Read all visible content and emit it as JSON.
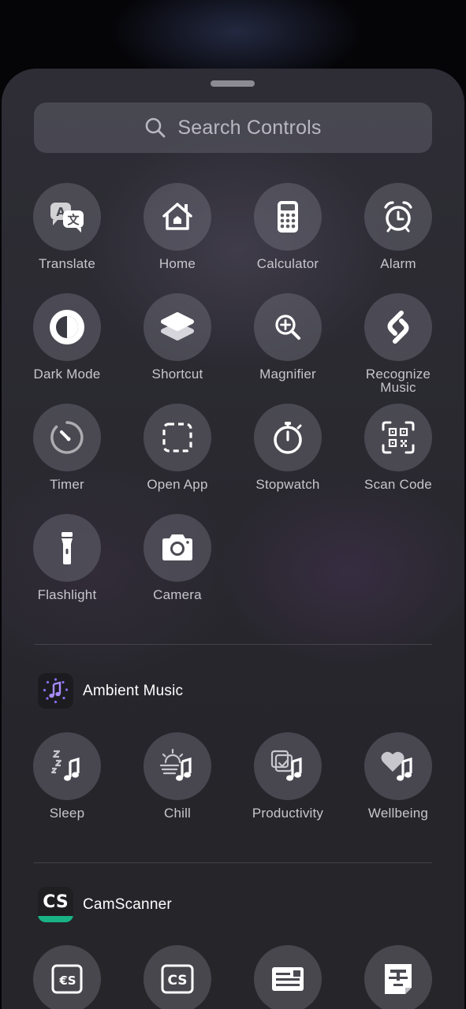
{
  "search": {
    "placeholder": "Search Controls"
  },
  "controls": [
    {
      "label": "Translate",
      "icon": "translate-icon"
    },
    {
      "label": "Home",
      "icon": "home-icon"
    },
    {
      "label": "Calculator",
      "icon": "calculator-icon"
    },
    {
      "label": "Alarm",
      "icon": "alarm-icon"
    },
    {
      "label": "Dark Mode",
      "icon": "dark-mode-icon"
    },
    {
      "label": "Shortcut",
      "icon": "shortcuts-icon"
    },
    {
      "label": "Magnifier",
      "icon": "magnifier-icon"
    },
    {
      "label": "Recognize Music",
      "icon": "shazam-icon"
    },
    {
      "label": "Timer",
      "icon": "timer-icon"
    },
    {
      "label": "Open App",
      "icon": "open-app-icon"
    },
    {
      "label": "Stopwatch",
      "icon": "stopwatch-icon"
    },
    {
      "label": "Scan Code",
      "icon": "qr-code-icon"
    },
    {
      "label": "Flashlight",
      "icon": "flashlight-icon"
    },
    {
      "label": "Camera",
      "icon": "camera-icon"
    }
  ],
  "ambient": {
    "app_name": "Ambient Music",
    "items": [
      {
        "label": "Sleep",
        "icon": "sleep-music-icon"
      },
      {
        "label": "Chill",
        "icon": "chill-music-icon"
      },
      {
        "label": "Productivity",
        "icon": "productivity-music-icon"
      },
      {
        "label": "Wellbeing",
        "icon": "wellbeing-music-icon"
      }
    ]
  },
  "camscanner": {
    "app_name": "CamScanner",
    "app_icon_text": "CS",
    "items": [
      {
        "icon": "camscanner-doc-icon"
      },
      {
        "icon": "camscanner-logo-icon"
      },
      {
        "icon": "id-card-icon"
      },
      {
        "icon": "text-extract-icon"
      }
    ]
  }
}
